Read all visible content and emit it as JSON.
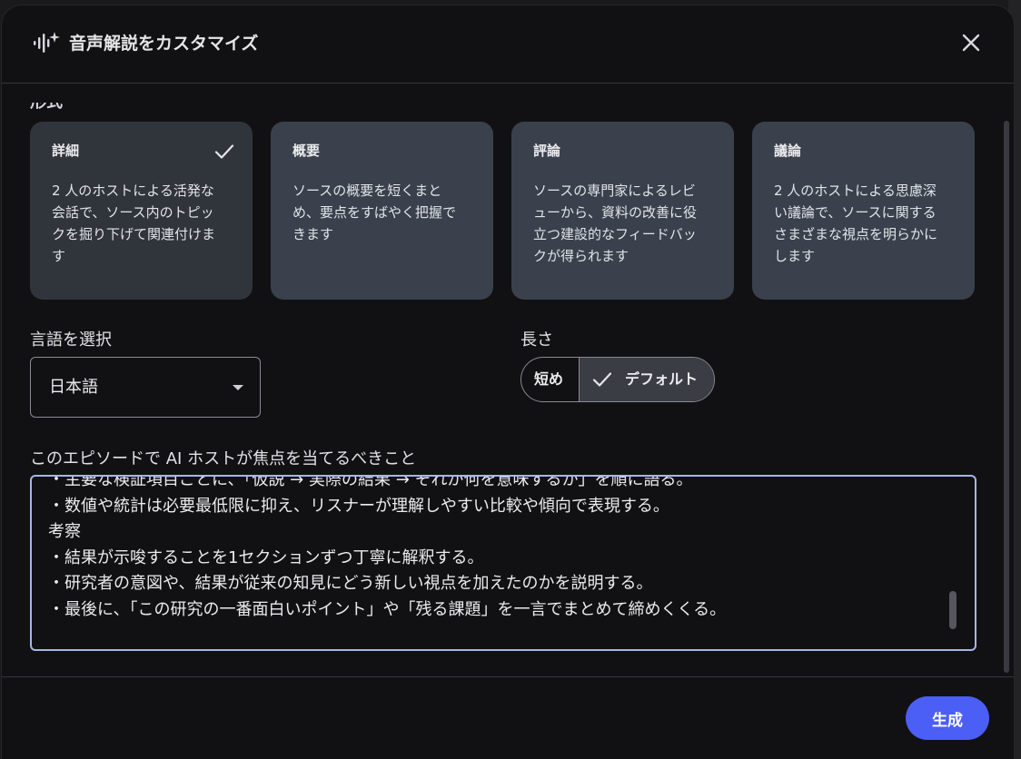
{
  "dialog": {
    "title": "音声解説をカスタマイズ",
    "icon": "audio-sparkle-icon",
    "close_icon": "close-icon"
  },
  "format": {
    "label": "形式",
    "options": [
      {
        "title": "詳細",
        "desc_lines": [
          "2 人のホストによる活発な",
          "会話で、ソース内のトピッ",
          "クを掘り下げて関連付けま",
          "す"
        ],
        "selected": true
      },
      {
        "title": "概要",
        "desc_lines": [
          "ソースの概要を短くまと",
          "め、要点をすばやく把握で",
          "きます"
        ],
        "selected": false
      },
      {
        "title": "評論",
        "desc_lines": [
          "ソースの専門家によるレビ",
          "ューから、資料の改善に役",
          "立つ建設的なフィードバッ",
          "クが得られます"
        ],
        "selected": false
      },
      {
        "title": "議論",
        "desc_lines": [
          "2 人のホストによる思慮深",
          "い議論で、ソースに関する",
          "さまざまな視点を明らかに",
          "します"
        ],
        "selected": false
      }
    ]
  },
  "language": {
    "label": "言語を選択",
    "value": "日本語"
  },
  "length": {
    "label": "長さ",
    "options": [
      "短め",
      "デフォルト"
    ],
    "selected": "デフォルト"
  },
  "focus": {
    "label": "このエピソードで AI ホストが焦点を当てるべきこと",
    "lines": [
      "・主要な検証項目ごとに、「仮説 → 実際の結果 → それが何を意味するか」を順に語る。",
      "・数値や統計は必要最低限に抑え、リスナーが理解しやすい比較や傾向で表現する。",
      "考察",
      "・結果が示唆することを1セクションずつ丁寧に解釈する。",
      "・研究者の意図や、結果が従来の知見にどう新しい視点を加えたのかを説明する。",
      "・最後に、「この研究の一番面白いポイント」や「残る課題」を一言でまとめて締めくくる。"
    ]
  },
  "footer": {
    "generate_label": "生成"
  },
  "colors": {
    "dialog_bg": "#111113",
    "card_bg": "#3a414c",
    "card_selected_bg": "#30343b",
    "focus_border": "#a6b6e6",
    "primary": "#4b5ef6"
  }
}
